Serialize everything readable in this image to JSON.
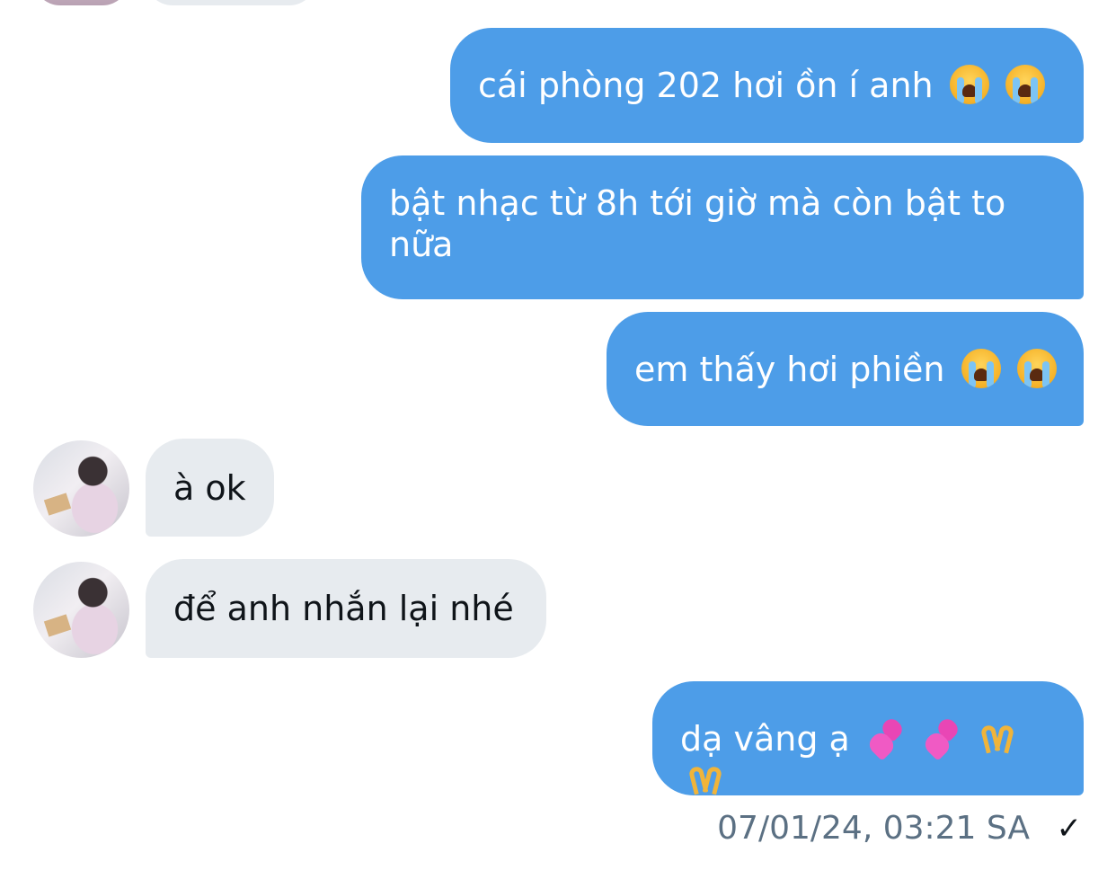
{
  "messages": [
    {
      "side": "out",
      "text": "cái phòng 202 hơi ồn í anh",
      "emoji": [
        "loudly-crying-face",
        "loudly-crying-face"
      ]
    },
    {
      "side": "out",
      "text": "bật nhạc từ 8h tới giờ mà còn bật to nữa"
    },
    {
      "side": "out",
      "text": "em thấy hơi phiền",
      "emoji": [
        "loudly-crying-face",
        "loudly-crying-face"
      ]
    },
    {
      "side": "in",
      "text": "à ok"
    },
    {
      "side": "in",
      "text": "để anh nhắn lại nhé"
    },
    {
      "side": "out",
      "text": "dạ vâng ạ",
      "emoji": [
        "two-hearts",
        "two-hearts",
        "heart-hands",
        "heart-hands"
      ]
    }
  ],
  "footer": {
    "timestamp": "07/01/24, 03:21 SA",
    "status_icon": "checkmark-icon",
    "status_glyph": "✓"
  },
  "colors": {
    "outgoing_bubble": "#4d9de8",
    "incoming_bubble": "#e7ebef",
    "timestamp_text": "#5b7083"
  }
}
